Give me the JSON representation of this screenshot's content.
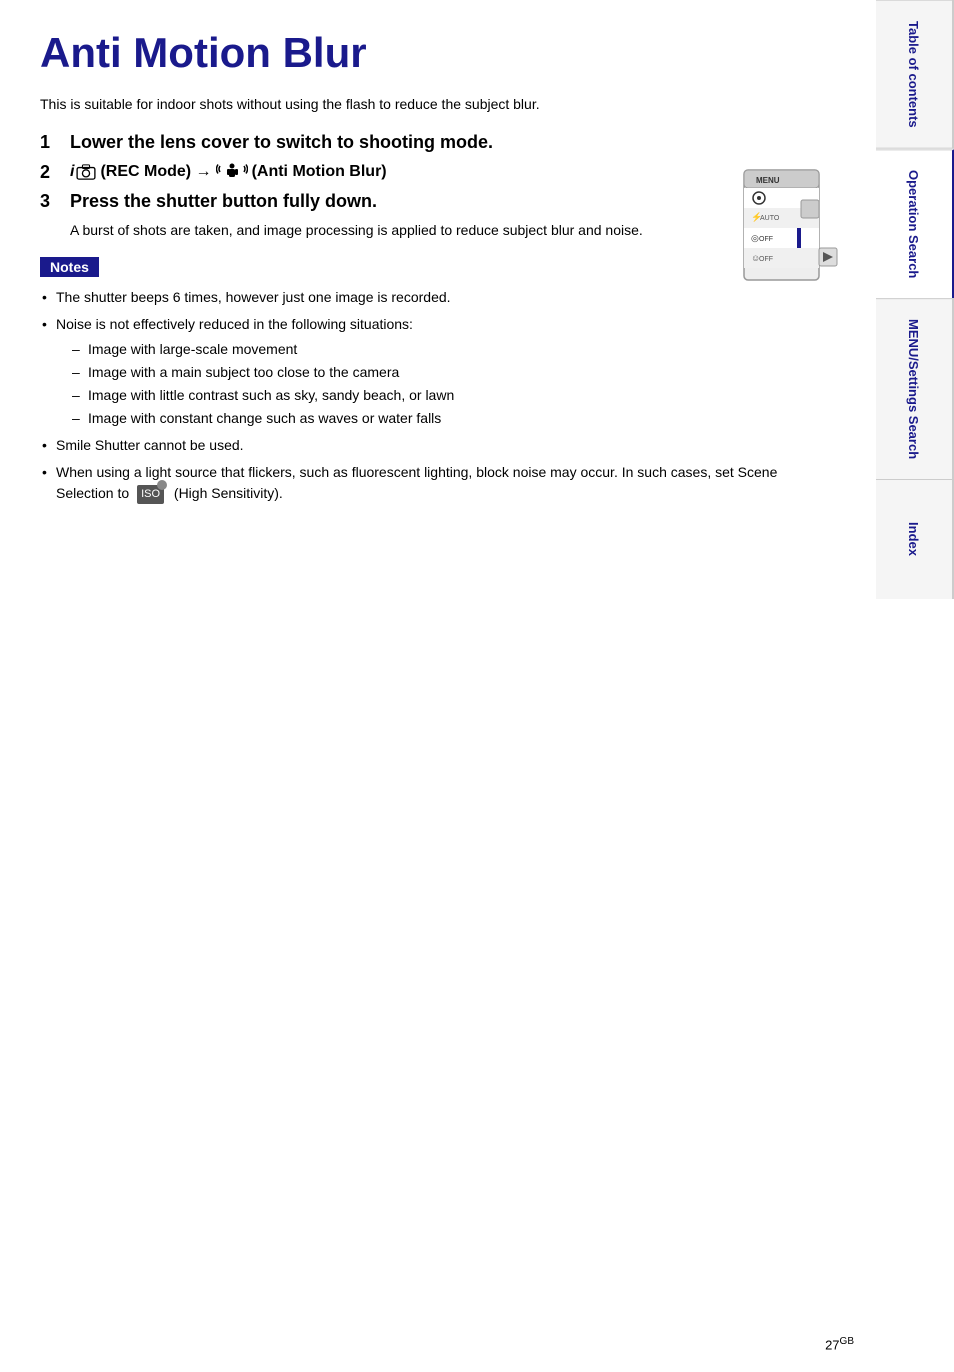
{
  "page": {
    "title": "Anti Motion Blur",
    "intro": "This is suitable for indoor shots without using the flash to reduce the subject blur.",
    "steps": [
      {
        "number": "1",
        "text": "Lower the lens cover to switch to shooting mode."
      },
      {
        "number": "2",
        "text_prefix": "(REC Mode) → ",
        "text_suffix": "(Anti Motion Blur)"
      },
      {
        "number": "3",
        "text": "Press the shutter button fully down.",
        "subtext": "A burst of shots are taken, and image processing is applied to reduce subject blur and noise."
      }
    ],
    "notes_label": "Notes",
    "notes": [
      "The shutter beeps 6 times, however just one image is recorded.",
      "Noise is not effectively reduced in the following situations:",
      "Smile Shutter cannot be used.",
      "When using a light source that flickers, such as fluorescent lighting, block noise may occur. In such cases, set Scene Selection to  (High Sensitivity)."
    ],
    "noise_subitems": [
      "Image with large-scale movement",
      "Image with a main subject too close to the camera",
      "Image with little contrast such as sky, sandy beach, or lawn",
      "Image with constant change such as waves or water falls"
    ],
    "page_number": "27",
    "page_suffix": "GB"
  },
  "sidebar": {
    "tabs": [
      {
        "id": "table-of-contents",
        "label": "Table of contents"
      },
      {
        "id": "operation-search",
        "label": "Operation Search"
      },
      {
        "id": "menu-settings-search",
        "label": "MENU/Settings Search"
      },
      {
        "id": "index",
        "label": "Index"
      }
    ]
  }
}
